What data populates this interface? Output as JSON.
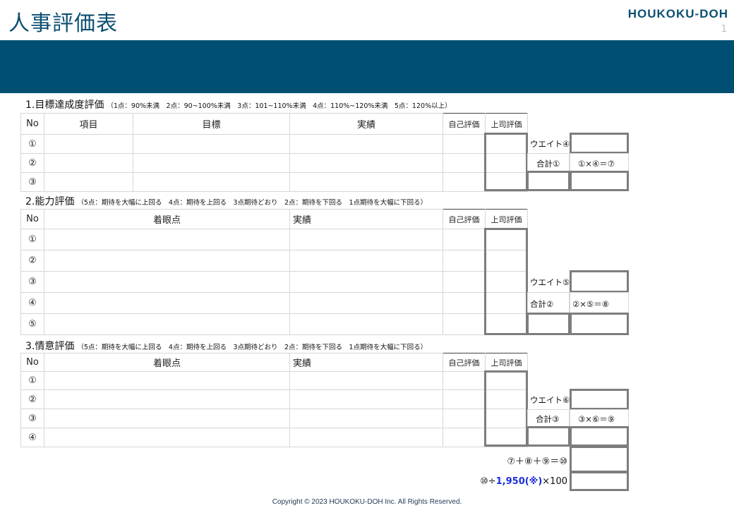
{
  "header": {
    "title": "人事評価表",
    "logo": "HOUKOKU-DOH",
    "page_number": "1"
  },
  "section1": {
    "title": "1.目標達成度評価",
    "note": "（1点：90%未満　2点：90~100%未満　3点：101~110%未満　4点：110%~120%未満　5点：120%以上）",
    "headers": {
      "no": "No",
      "item": "項目",
      "goal": "目標",
      "result": "実績",
      "self": "自己評価",
      "boss": "上司評価"
    },
    "rows": [
      "①",
      "②",
      "③"
    ],
    "weight_label": "ウエイト④",
    "total_label": "合計①",
    "formula_label": "①×④＝⑦"
  },
  "section2": {
    "title": "2.能力評価",
    "note": "（5点：期待を大幅に上回る　4点：期待を上回る　3点期待どおり　2点：期待を下回る　1点期待を大幅に下回る）",
    "headers": {
      "no": "No",
      "focus": "着眼点",
      "result": "実績",
      "self": "自己評価",
      "boss": "上司評価"
    },
    "rows": [
      "①",
      "②",
      "③",
      "④",
      "⑤"
    ],
    "weight_label": "ウエイト⑤",
    "total_label": "合計②",
    "formula_label": "②×⑤＝⑧"
  },
  "section3": {
    "title": "3.情意評価",
    "note": "（5点：期待を大幅に上回る　4点：期待を上回る　3点期待どおり　2点：期待を下回る　1点期待を大幅に下回る）",
    "headers": {
      "no": "No",
      "focus": "着眼点",
      "result": "実績",
      "self": "自己評価",
      "boss": "上司評価"
    },
    "rows": [
      "①",
      "②",
      "③",
      "④"
    ],
    "weight_label": "ウエイト⑥",
    "total_label": "合計③",
    "formula_label": "③×⑥＝⑨"
  },
  "summary": {
    "sum_formula": "⑦＋⑧＋⑨＝⑩",
    "ratio_prefix": "⑩÷",
    "ratio_value": "1,950(※)",
    "ratio_suffix": "×100"
  },
  "footer": {
    "copyright": "Copyright © 2023 HOUKOKU-DOH Inc. All Rights Reserved."
  }
}
